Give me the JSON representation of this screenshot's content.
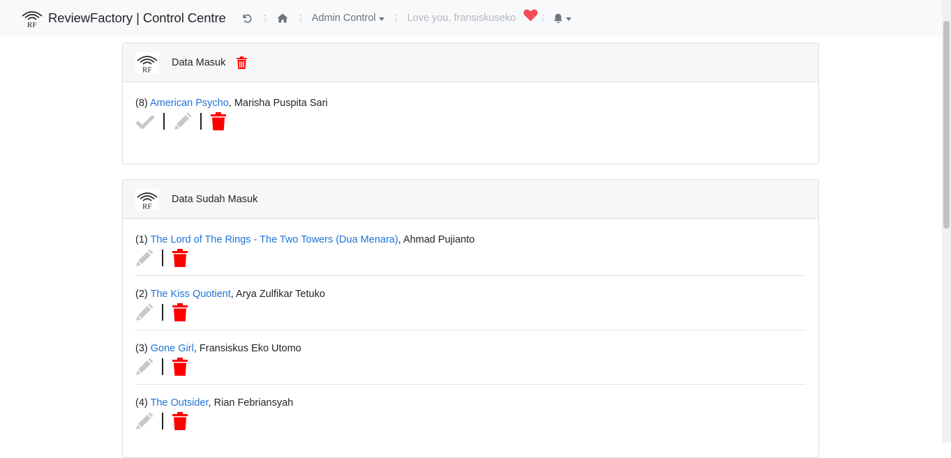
{
  "navbar": {
    "brand": "ReviewFactory | Control Centre",
    "logo_text": "RF",
    "admin_menu_label": "Admin Control",
    "greeting": "Love you, fransiskuseko",
    "icons": [
      "undo-icon",
      "home-icon",
      "heart-icon",
      "bell-icon"
    ],
    "colors": {
      "heart": "#f44c5a",
      "nav_text": "#6c757d",
      "greeting": "#b4b8bc"
    }
  },
  "pending": {
    "title": "Data Masuk",
    "items": [
      {
        "number": "(8)",
        "title": "American Psycho",
        "separator": ",",
        "author": " Marisha Puspita Sari"
      }
    ]
  },
  "submitted": {
    "title": "Data Sudah Masuk",
    "items": [
      {
        "number": "(1)",
        "title": "The Lord of The Rings - The Two Towers (Dua Menara)",
        "separator": ",",
        "author": " Ahmad Pujianto"
      },
      {
        "number": "(2)",
        "title": "The Kiss Quotient",
        "separator": ",",
        "author": " Arya Zulfikar Tetuko"
      },
      {
        "number": "(3)",
        "title": "Gone Girl",
        "separator": ",",
        "author": " Fransiskus Eko Utomo"
      },
      {
        "number": "(4)",
        "title": "The Outsider",
        "separator": ",",
        "author": " Rian Febriansyah"
      }
    ]
  },
  "colors": {
    "link": "#1e73d8",
    "trash": "#ff0000",
    "disabled_icon": "#c8c8c8"
  }
}
